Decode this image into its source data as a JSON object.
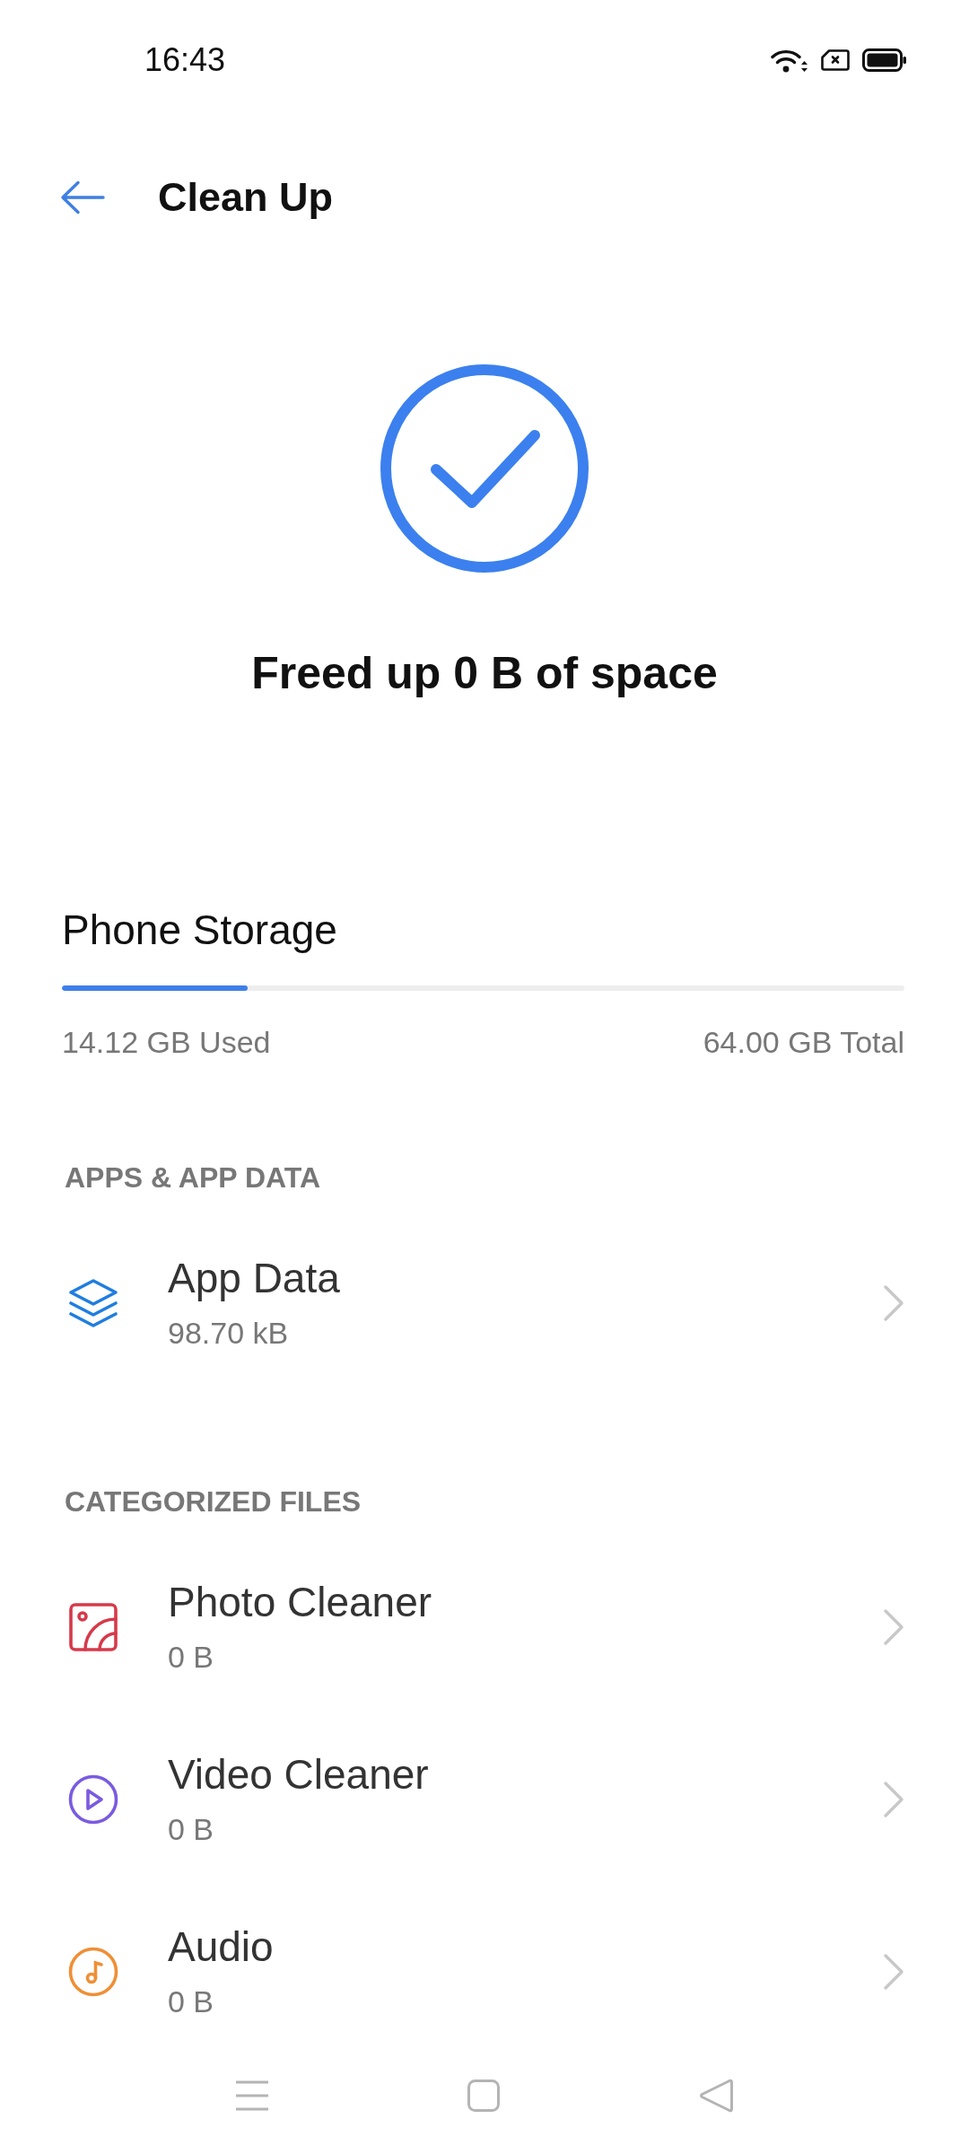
{
  "status_bar": {
    "time": "16:43"
  },
  "header": {
    "title": "Clean Up"
  },
  "result": {
    "message": "Freed up 0 B of space"
  },
  "storage": {
    "title": "Phone Storage",
    "level": 0.22,
    "used": "14.12 GB Used",
    "total": "64.00 GB Total"
  },
  "sections": [
    {
      "heading": "APPS & APP DATA",
      "items": [
        {
          "kind": "apps",
          "title": "App Data",
          "size": "98.70 kB",
          "color": "#1f7ee0"
        }
      ]
    },
    {
      "heading": "CATEGORIZED FILES",
      "items": [
        {
          "kind": "photo",
          "title": "Photo Cleaner",
          "size": "0 B",
          "color": "#d63a4a"
        },
        {
          "kind": "video",
          "title": "Video Cleaner",
          "size": "0 B",
          "color": "#7a5be0"
        },
        {
          "kind": "audio",
          "title": "Audio",
          "size": "0 B",
          "color": "#ef8f35"
        }
      ]
    }
  ]
}
